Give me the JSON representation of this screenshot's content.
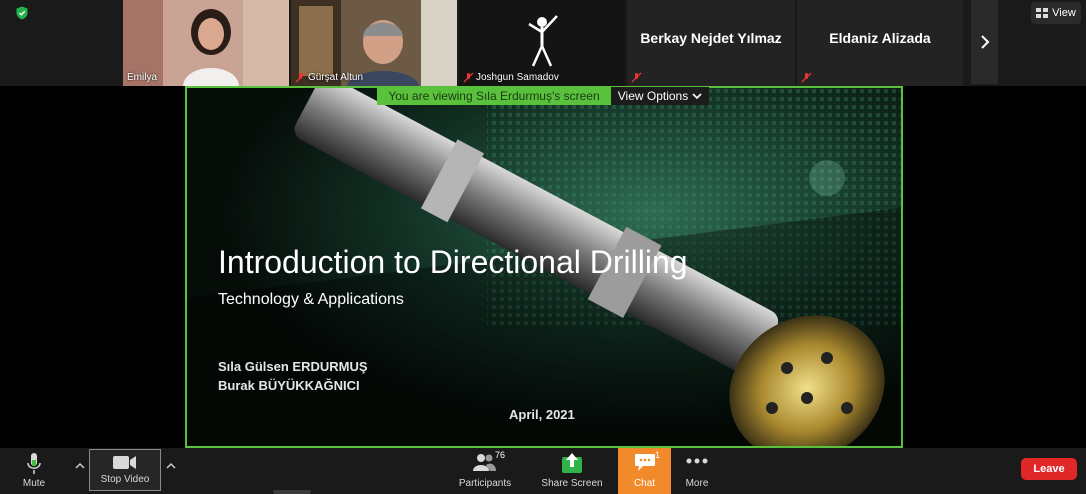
{
  "participants": [
    {
      "name": "Emilya",
      "muted": false
    },
    {
      "name": "Gürşat Altun",
      "muted": true
    },
    {
      "name": "Joshgun Samadov",
      "muted": true
    },
    {
      "name": "Berkay Nejdet Yılmaz",
      "muted": true
    },
    {
      "name": "Eldaniz Alizada",
      "muted": true
    }
  ],
  "header": {
    "view_label": "View"
  },
  "share": {
    "banner": "You are viewing Sıla Erdurmuş's screen",
    "view_options": "View Options"
  },
  "slide": {
    "title": "Introduction to Directional Drilling",
    "subtitle": "Technology  & Applications",
    "author1": "Sıla Gülsen ERDURMUŞ",
    "author2": "Burak BÜYÜKKAĞNICI",
    "date": "April, 2021"
  },
  "toolbar": {
    "mute": "Mute",
    "stop_video": "Stop Video",
    "participants": "Participants",
    "participants_count": "76",
    "share_screen": "Share Screen",
    "chat": "Chat",
    "chat_count": "1",
    "more": "More",
    "leave": "Leave"
  },
  "colors": {
    "accent_green": "#59c13c",
    "chat_orange": "#f08a2a",
    "leave_red": "#e02828",
    "share_green": "#2fb34a"
  }
}
